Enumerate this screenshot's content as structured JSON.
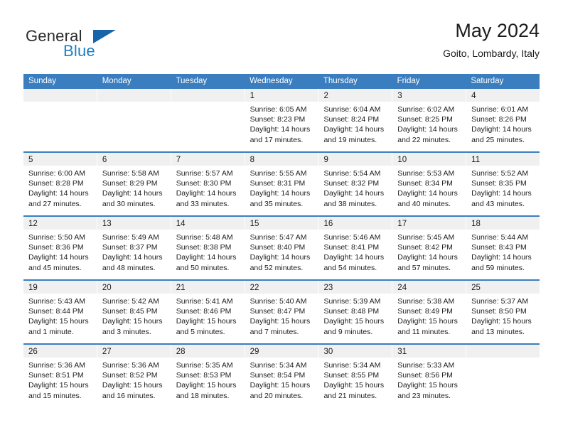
{
  "brand": {
    "name_part1": "General",
    "name_part2": "Blue",
    "logo_icon": "triangle-flag-icon"
  },
  "header": {
    "title": "May 2024",
    "location": "Goito, Lombardy, Italy"
  },
  "weekdays": [
    "Sunday",
    "Monday",
    "Tuesday",
    "Wednesday",
    "Thursday",
    "Friday",
    "Saturday"
  ],
  "colors": {
    "header_blue": "#3a7ec0",
    "brand_blue": "#1d7ec4",
    "logo_blue": "#1565a8",
    "day_strip_gray": "#f0f0f0",
    "text": "#1c1c1c"
  },
  "weeks": [
    [
      {
        "day": "",
        "lines": []
      },
      {
        "day": "",
        "lines": []
      },
      {
        "day": "",
        "lines": []
      },
      {
        "day": "1",
        "lines": [
          "Sunrise: 6:05 AM",
          "Sunset: 8:23 PM",
          "Daylight: 14 hours",
          "and 17 minutes."
        ]
      },
      {
        "day": "2",
        "lines": [
          "Sunrise: 6:04 AM",
          "Sunset: 8:24 PM",
          "Daylight: 14 hours",
          "and 19 minutes."
        ]
      },
      {
        "day": "3",
        "lines": [
          "Sunrise: 6:02 AM",
          "Sunset: 8:25 PM",
          "Daylight: 14 hours",
          "and 22 minutes."
        ]
      },
      {
        "day": "4",
        "lines": [
          "Sunrise: 6:01 AM",
          "Sunset: 8:26 PM",
          "Daylight: 14 hours",
          "and 25 minutes."
        ]
      }
    ],
    [
      {
        "day": "5",
        "lines": [
          "Sunrise: 6:00 AM",
          "Sunset: 8:28 PM",
          "Daylight: 14 hours",
          "and 27 minutes."
        ]
      },
      {
        "day": "6",
        "lines": [
          "Sunrise: 5:58 AM",
          "Sunset: 8:29 PM",
          "Daylight: 14 hours",
          "and 30 minutes."
        ]
      },
      {
        "day": "7",
        "lines": [
          "Sunrise: 5:57 AM",
          "Sunset: 8:30 PM",
          "Daylight: 14 hours",
          "and 33 minutes."
        ]
      },
      {
        "day": "8",
        "lines": [
          "Sunrise: 5:55 AM",
          "Sunset: 8:31 PM",
          "Daylight: 14 hours",
          "and 35 minutes."
        ]
      },
      {
        "day": "9",
        "lines": [
          "Sunrise: 5:54 AM",
          "Sunset: 8:32 PM",
          "Daylight: 14 hours",
          "and 38 minutes."
        ]
      },
      {
        "day": "10",
        "lines": [
          "Sunrise: 5:53 AM",
          "Sunset: 8:34 PM",
          "Daylight: 14 hours",
          "and 40 minutes."
        ]
      },
      {
        "day": "11",
        "lines": [
          "Sunrise: 5:52 AM",
          "Sunset: 8:35 PM",
          "Daylight: 14 hours",
          "and 43 minutes."
        ]
      }
    ],
    [
      {
        "day": "12",
        "lines": [
          "Sunrise: 5:50 AM",
          "Sunset: 8:36 PM",
          "Daylight: 14 hours",
          "and 45 minutes."
        ]
      },
      {
        "day": "13",
        "lines": [
          "Sunrise: 5:49 AM",
          "Sunset: 8:37 PM",
          "Daylight: 14 hours",
          "and 48 minutes."
        ]
      },
      {
        "day": "14",
        "lines": [
          "Sunrise: 5:48 AM",
          "Sunset: 8:38 PM",
          "Daylight: 14 hours",
          "and 50 minutes."
        ]
      },
      {
        "day": "15",
        "lines": [
          "Sunrise: 5:47 AM",
          "Sunset: 8:40 PM",
          "Daylight: 14 hours",
          "and 52 minutes."
        ]
      },
      {
        "day": "16",
        "lines": [
          "Sunrise: 5:46 AM",
          "Sunset: 8:41 PM",
          "Daylight: 14 hours",
          "and 54 minutes."
        ]
      },
      {
        "day": "17",
        "lines": [
          "Sunrise: 5:45 AM",
          "Sunset: 8:42 PM",
          "Daylight: 14 hours",
          "and 57 minutes."
        ]
      },
      {
        "day": "18",
        "lines": [
          "Sunrise: 5:44 AM",
          "Sunset: 8:43 PM",
          "Daylight: 14 hours",
          "and 59 minutes."
        ]
      }
    ],
    [
      {
        "day": "19",
        "lines": [
          "Sunrise: 5:43 AM",
          "Sunset: 8:44 PM",
          "Daylight: 15 hours",
          "and 1 minute."
        ]
      },
      {
        "day": "20",
        "lines": [
          "Sunrise: 5:42 AM",
          "Sunset: 8:45 PM",
          "Daylight: 15 hours",
          "and 3 minutes."
        ]
      },
      {
        "day": "21",
        "lines": [
          "Sunrise: 5:41 AM",
          "Sunset: 8:46 PM",
          "Daylight: 15 hours",
          "and 5 minutes."
        ]
      },
      {
        "day": "22",
        "lines": [
          "Sunrise: 5:40 AM",
          "Sunset: 8:47 PM",
          "Daylight: 15 hours",
          "and 7 minutes."
        ]
      },
      {
        "day": "23",
        "lines": [
          "Sunrise: 5:39 AM",
          "Sunset: 8:48 PM",
          "Daylight: 15 hours",
          "and 9 minutes."
        ]
      },
      {
        "day": "24",
        "lines": [
          "Sunrise: 5:38 AM",
          "Sunset: 8:49 PM",
          "Daylight: 15 hours",
          "and 11 minutes."
        ]
      },
      {
        "day": "25",
        "lines": [
          "Sunrise: 5:37 AM",
          "Sunset: 8:50 PM",
          "Daylight: 15 hours",
          "and 13 minutes."
        ]
      }
    ],
    [
      {
        "day": "26",
        "lines": [
          "Sunrise: 5:36 AM",
          "Sunset: 8:51 PM",
          "Daylight: 15 hours",
          "and 15 minutes."
        ]
      },
      {
        "day": "27",
        "lines": [
          "Sunrise: 5:36 AM",
          "Sunset: 8:52 PM",
          "Daylight: 15 hours",
          "and 16 minutes."
        ]
      },
      {
        "day": "28",
        "lines": [
          "Sunrise: 5:35 AM",
          "Sunset: 8:53 PM",
          "Daylight: 15 hours",
          "and 18 minutes."
        ]
      },
      {
        "day": "29",
        "lines": [
          "Sunrise: 5:34 AM",
          "Sunset: 8:54 PM",
          "Daylight: 15 hours",
          "and 20 minutes."
        ]
      },
      {
        "day": "30",
        "lines": [
          "Sunrise: 5:34 AM",
          "Sunset: 8:55 PM",
          "Daylight: 15 hours",
          "and 21 minutes."
        ]
      },
      {
        "day": "31",
        "lines": [
          "Sunrise: 5:33 AM",
          "Sunset: 8:56 PM",
          "Daylight: 15 hours",
          "and 23 minutes."
        ]
      },
      {
        "day": "",
        "lines": []
      }
    ]
  ]
}
